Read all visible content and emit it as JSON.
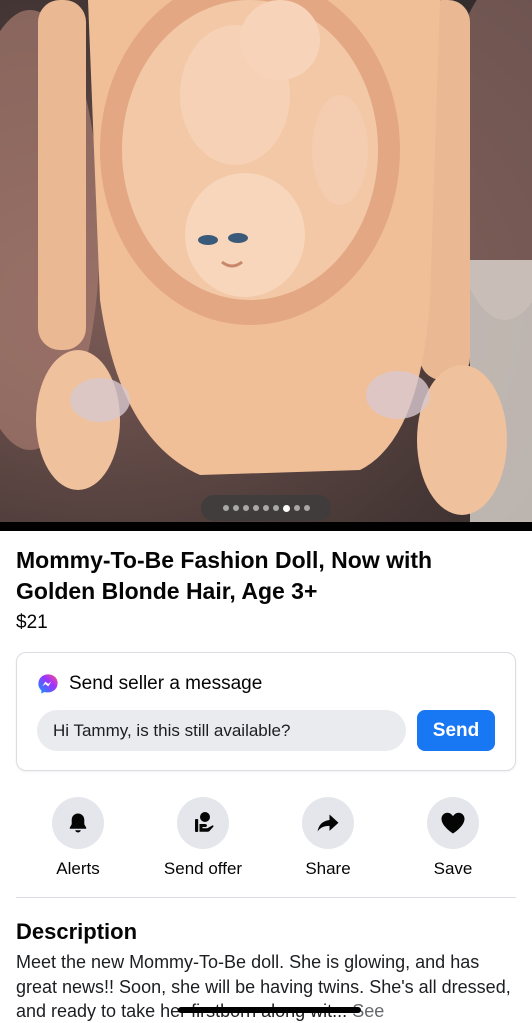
{
  "listing": {
    "title": "Mommy-To-Be Fashion Doll, Now with Golden Blonde Hair, Age 3+",
    "price": "$21"
  },
  "photo": {
    "total_images": 9,
    "active_index": 7
  },
  "message": {
    "heading": "Send seller a message",
    "input_value": "Hi Tammy, is this still available?",
    "send_label": "Send"
  },
  "actions": [
    {
      "label": "Alerts",
      "icon": "bell-icon"
    },
    {
      "label": "Send offer",
      "icon": "offer-icon"
    },
    {
      "label": "Share",
      "icon": "share-icon"
    },
    {
      "label": "Save",
      "icon": "heart-icon"
    }
  ],
  "description": {
    "heading": "Description",
    "text": "Meet the new Mommy-To-Be doll. She is glowing, and has great news!! Soon, she will be having twins. She's all dressed, and ready to take her firstborn along wit...",
    "see_more": "See"
  },
  "colors": {
    "accent": "#1877f2",
    "action_circle": "#e4e6eb"
  }
}
